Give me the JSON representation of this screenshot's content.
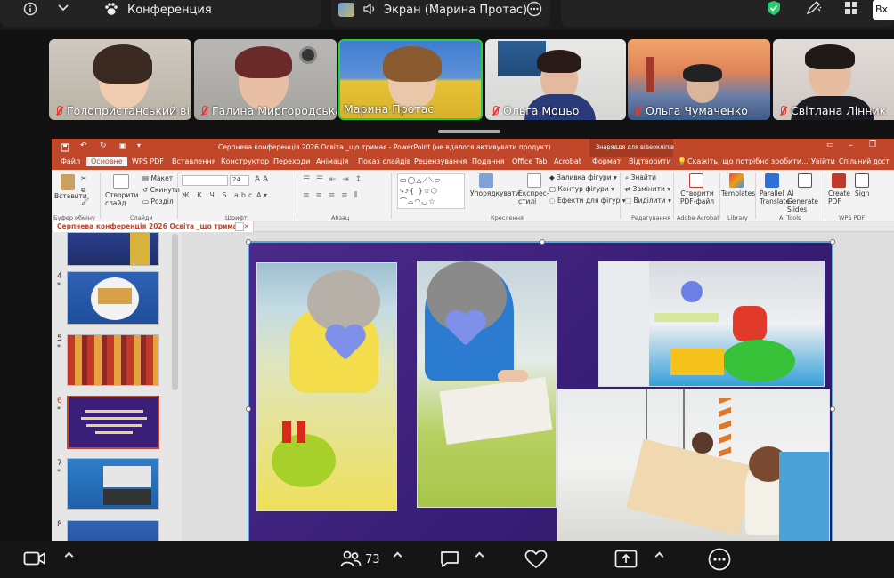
{
  "topbar": {
    "app_label": "Конференция",
    "screen_share_label": "Экран (Марина Протас)",
    "enter_button": "Вх"
  },
  "participants": [
    {
      "name": "Голопристанський ві..."
    },
    {
      "name": "Галина Миргородська"
    },
    {
      "name": "Марина Протас"
    },
    {
      "name": "Ольга Моцьо"
    },
    {
      "name": "Ольга Чумаченко"
    },
    {
      "name": "Світлана Лінник"
    }
  ],
  "ppt": {
    "window_title": "Серпнева конференція 2026  Освіта _що тримає - PowerPoint (не вдалося активувати продукт)",
    "contextual_tab": "Знаряддя для відеокліпів",
    "tabs": [
      "Файл",
      "Основне",
      "WPS PDF",
      "Вставлення",
      "Конструктор",
      "Переходи",
      "Анімація",
      "Показ слайдів",
      "Рецензування",
      "Подання",
      "Office Tab",
      "Acrobat",
      "Формат",
      "Відтворити"
    ],
    "search_placeholder": "Скажіть, що потрібно зробити...",
    "signin_label": "Увійти",
    "share_label": "Спільний дост",
    "ribbon": {
      "paste": "Вставити",
      "clipboard_group": "Буфер обміну",
      "new_slide": "Створити слайд",
      "layout": "Макет",
      "reset": "Скинути",
      "section": "Розділ",
      "slides_group": "Слайди",
      "font_group": "Шрифт",
      "font_size": "24",
      "paragraph_group": "Абзац",
      "drawing_group": "Креслення",
      "arrange": "Упорядкувати",
      "quick_styles": "Експрес-стилі",
      "shape_fill": "Заливка фігури",
      "shape_outline": "Контур фігури",
      "shape_effects": "Ефекти для фігур",
      "find": "Знайти",
      "replace": "Замінити",
      "select": "Виділити",
      "editing_group": "Редагування",
      "create_pdf_ua": "Створити PDF-файл",
      "adobe_group": "Adobe Acrobat",
      "templates": "Templates",
      "library_group": "Library",
      "parallel_translate": "Parallel Translate",
      "ai_generate": "AI Generate Slides",
      "ai_group": "AI Tools",
      "create_pdf": "Create PDF",
      "sign": "Sign",
      "wps_group": "WPS PDF"
    },
    "doc_tab": "Серпнева конференція 2026  Освіта _що тримає",
    "thumbnails": [
      {
        "num": "",
        "star": ""
      },
      {
        "num": "4",
        "star": "*"
      },
      {
        "num": "5",
        "star": "*"
      },
      {
        "num": "6",
        "star": "*"
      },
      {
        "num": "7",
        "star": "*"
      },
      {
        "num": "8",
        "star": ""
      }
    ]
  },
  "bottombar": {
    "participants_count": "73"
  },
  "colors": {
    "ppt_accent": "#c0472a",
    "active_speaker": "#2ecc40",
    "slide_bg": "#3a1f78"
  }
}
